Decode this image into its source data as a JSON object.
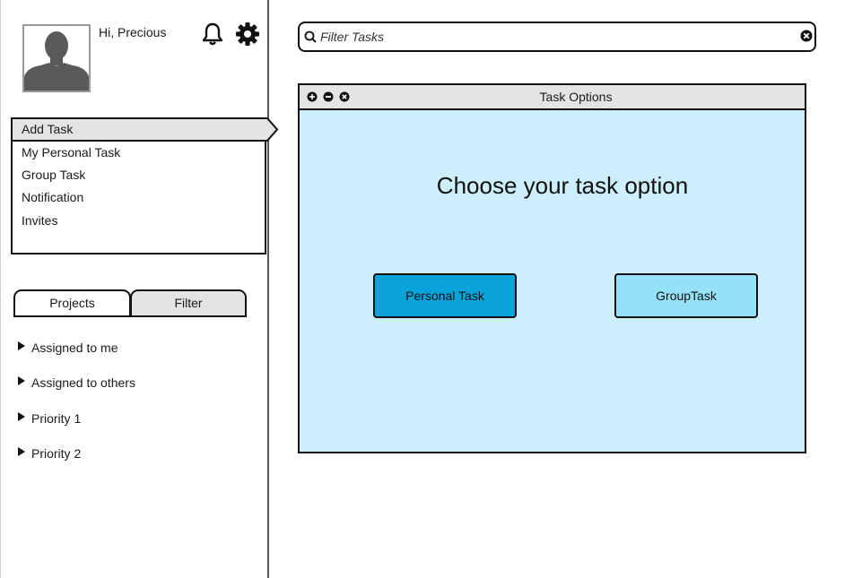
{
  "profile": {
    "greeting": "Hi, Precious"
  },
  "nav": {
    "items": [
      {
        "label": "Add Task",
        "active": true
      },
      {
        "label": "My Personal Task"
      },
      {
        "label": "Group Task"
      },
      {
        "label": "Notification"
      },
      {
        "label": "Invites"
      }
    ]
  },
  "tabs": [
    {
      "label": "Projects",
      "selected": true
    },
    {
      "label": "Filter"
    }
  ],
  "tree": [
    {
      "label": "Assigned to me"
    },
    {
      "label": "Assigned to others"
    },
    {
      "label": "Priority 1"
    },
    {
      "label": "Priority 2"
    }
  ],
  "search": {
    "placeholder": "Filter Tasks",
    "value": ""
  },
  "dialog": {
    "title": "Task Options",
    "prompt": "Choose your task option",
    "buttons": [
      {
        "label": "Personal Task"
      },
      {
        "label": "GroupTask"
      }
    ]
  },
  "icons": {
    "notifications": "bell-icon",
    "settings": "gear-icon",
    "search": "search-icon",
    "clear": "close-circle-icon"
  },
  "colors": {
    "dialog_bg": "#cceffb",
    "primary_button": "#0aa3d9",
    "secondary_button": "#94e1f8",
    "titlebar": "#e4e4e4"
  }
}
